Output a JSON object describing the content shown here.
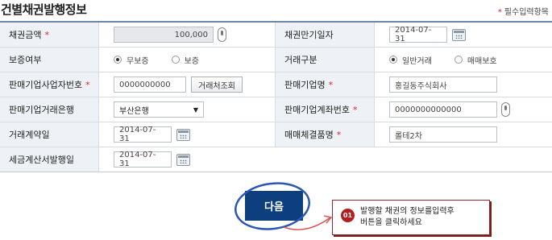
{
  "header": {
    "title": "건별채권발행정보",
    "required_star": "*",
    "required_note": "필수입력항목"
  },
  "form": {
    "row1": {
      "label1": "채권금액",
      "star1": "*",
      "amount": "100,000",
      "label2": "채권만기일자",
      "maturity_date": "2014-07-31"
    },
    "row2": {
      "label1": "보증여부",
      "opt_no_guarantee": "무보증",
      "opt_guarantee": "보증",
      "label2": "거래구분",
      "opt_general": "일반거래",
      "opt_factoring": "매매보호"
    },
    "row3": {
      "label1": "판매기업사업자번호",
      "star1": "*",
      "biz_no": "0000000000",
      "lookup_button": "거래처조회",
      "label2": "판매기업명",
      "star2": "*",
      "company_name": "홍길동주식회사"
    },
    "row4": {
      "label1": "판매기업거래은행",
      "bank": "부산은행",
      "select_arrow": "▼",
      "label2": "판매기업계좌번호",
      "star2": "*",
      "account_no": "0000000000000"
    },
    "row5": {
      "label1": "거래계약일",
      "contract_date": "2014-07-31",
      "label2": "매매체결품명",
      "star2": "*",
      "item_name": "롤테2차"
    },
    "row6": {
      "label1": "세금계산서발행일",
      "invoice_date": "2014-07-31"
    }
  },
  "actions": {
    "next_button": "다음"
  },
  "callout": {
    "number": "01",
    "line1": "발행할 채권의 정보를입력후",
    "line2": "버튼을 클릭하세요"
  },
  "colors": {
    "next_button_bg": "#0d3e7e",
    "highlight_ellipse": "#2a56b8",
    "callout_accent": "#b51e1e",
    "required_star": "#dd2233"
  }
}
